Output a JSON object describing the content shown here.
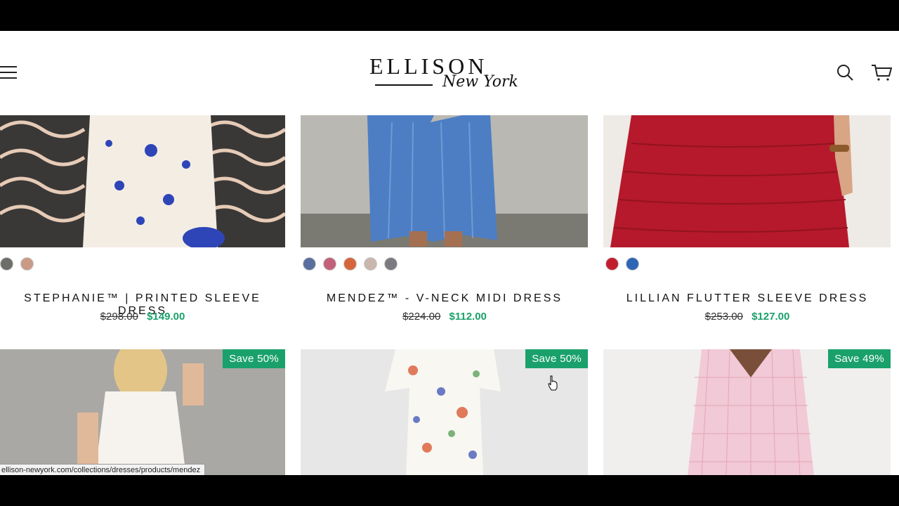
{
  "brand": {
    "name": "ELLISON",
    "tagline": "New York"
  },
  "status_url": "ellison-newyork.com/collections/dresses/products/mendez",
  "products_row1": [
    {
      "title": "STEPHANIE™ | PRINTED SLEEVE DRESS",
      "old_price": "$298.00",
      "new_price": "$149.00",
      "swatches": [
        "#6d6e6a",
        "#c99a85"
      ]
    },
    {
      "title": "MENDEZ™ - V-NECK MIDI DRESS",
      "old_price": "$224.00",
      "new_price": "$112.00",
      "swatches": [
        "#5a6f9e",
        "#c2617a",
        "#d6653c",
        "#c9b7ae",
        "#7a7a80"
      ]
    },
    {
      "title": "LILLIAN FLUTTER SLEEVE DRESS",
      "old_price": "$253.00",
      "new_price": "$127.00",
      "swatches": [
        "#c11e2d",
        "#2d66b5"
      ]
    }
  ],
  "products_row2": [
    {
      "badge": "Save 50%"
    },
    {
      "badge": "Save 50%"
    },
    {
      "badge": "Save 49%"
    }
  ],
  "colors": {
    "accent_green": "#1aa16b"
  }
}
